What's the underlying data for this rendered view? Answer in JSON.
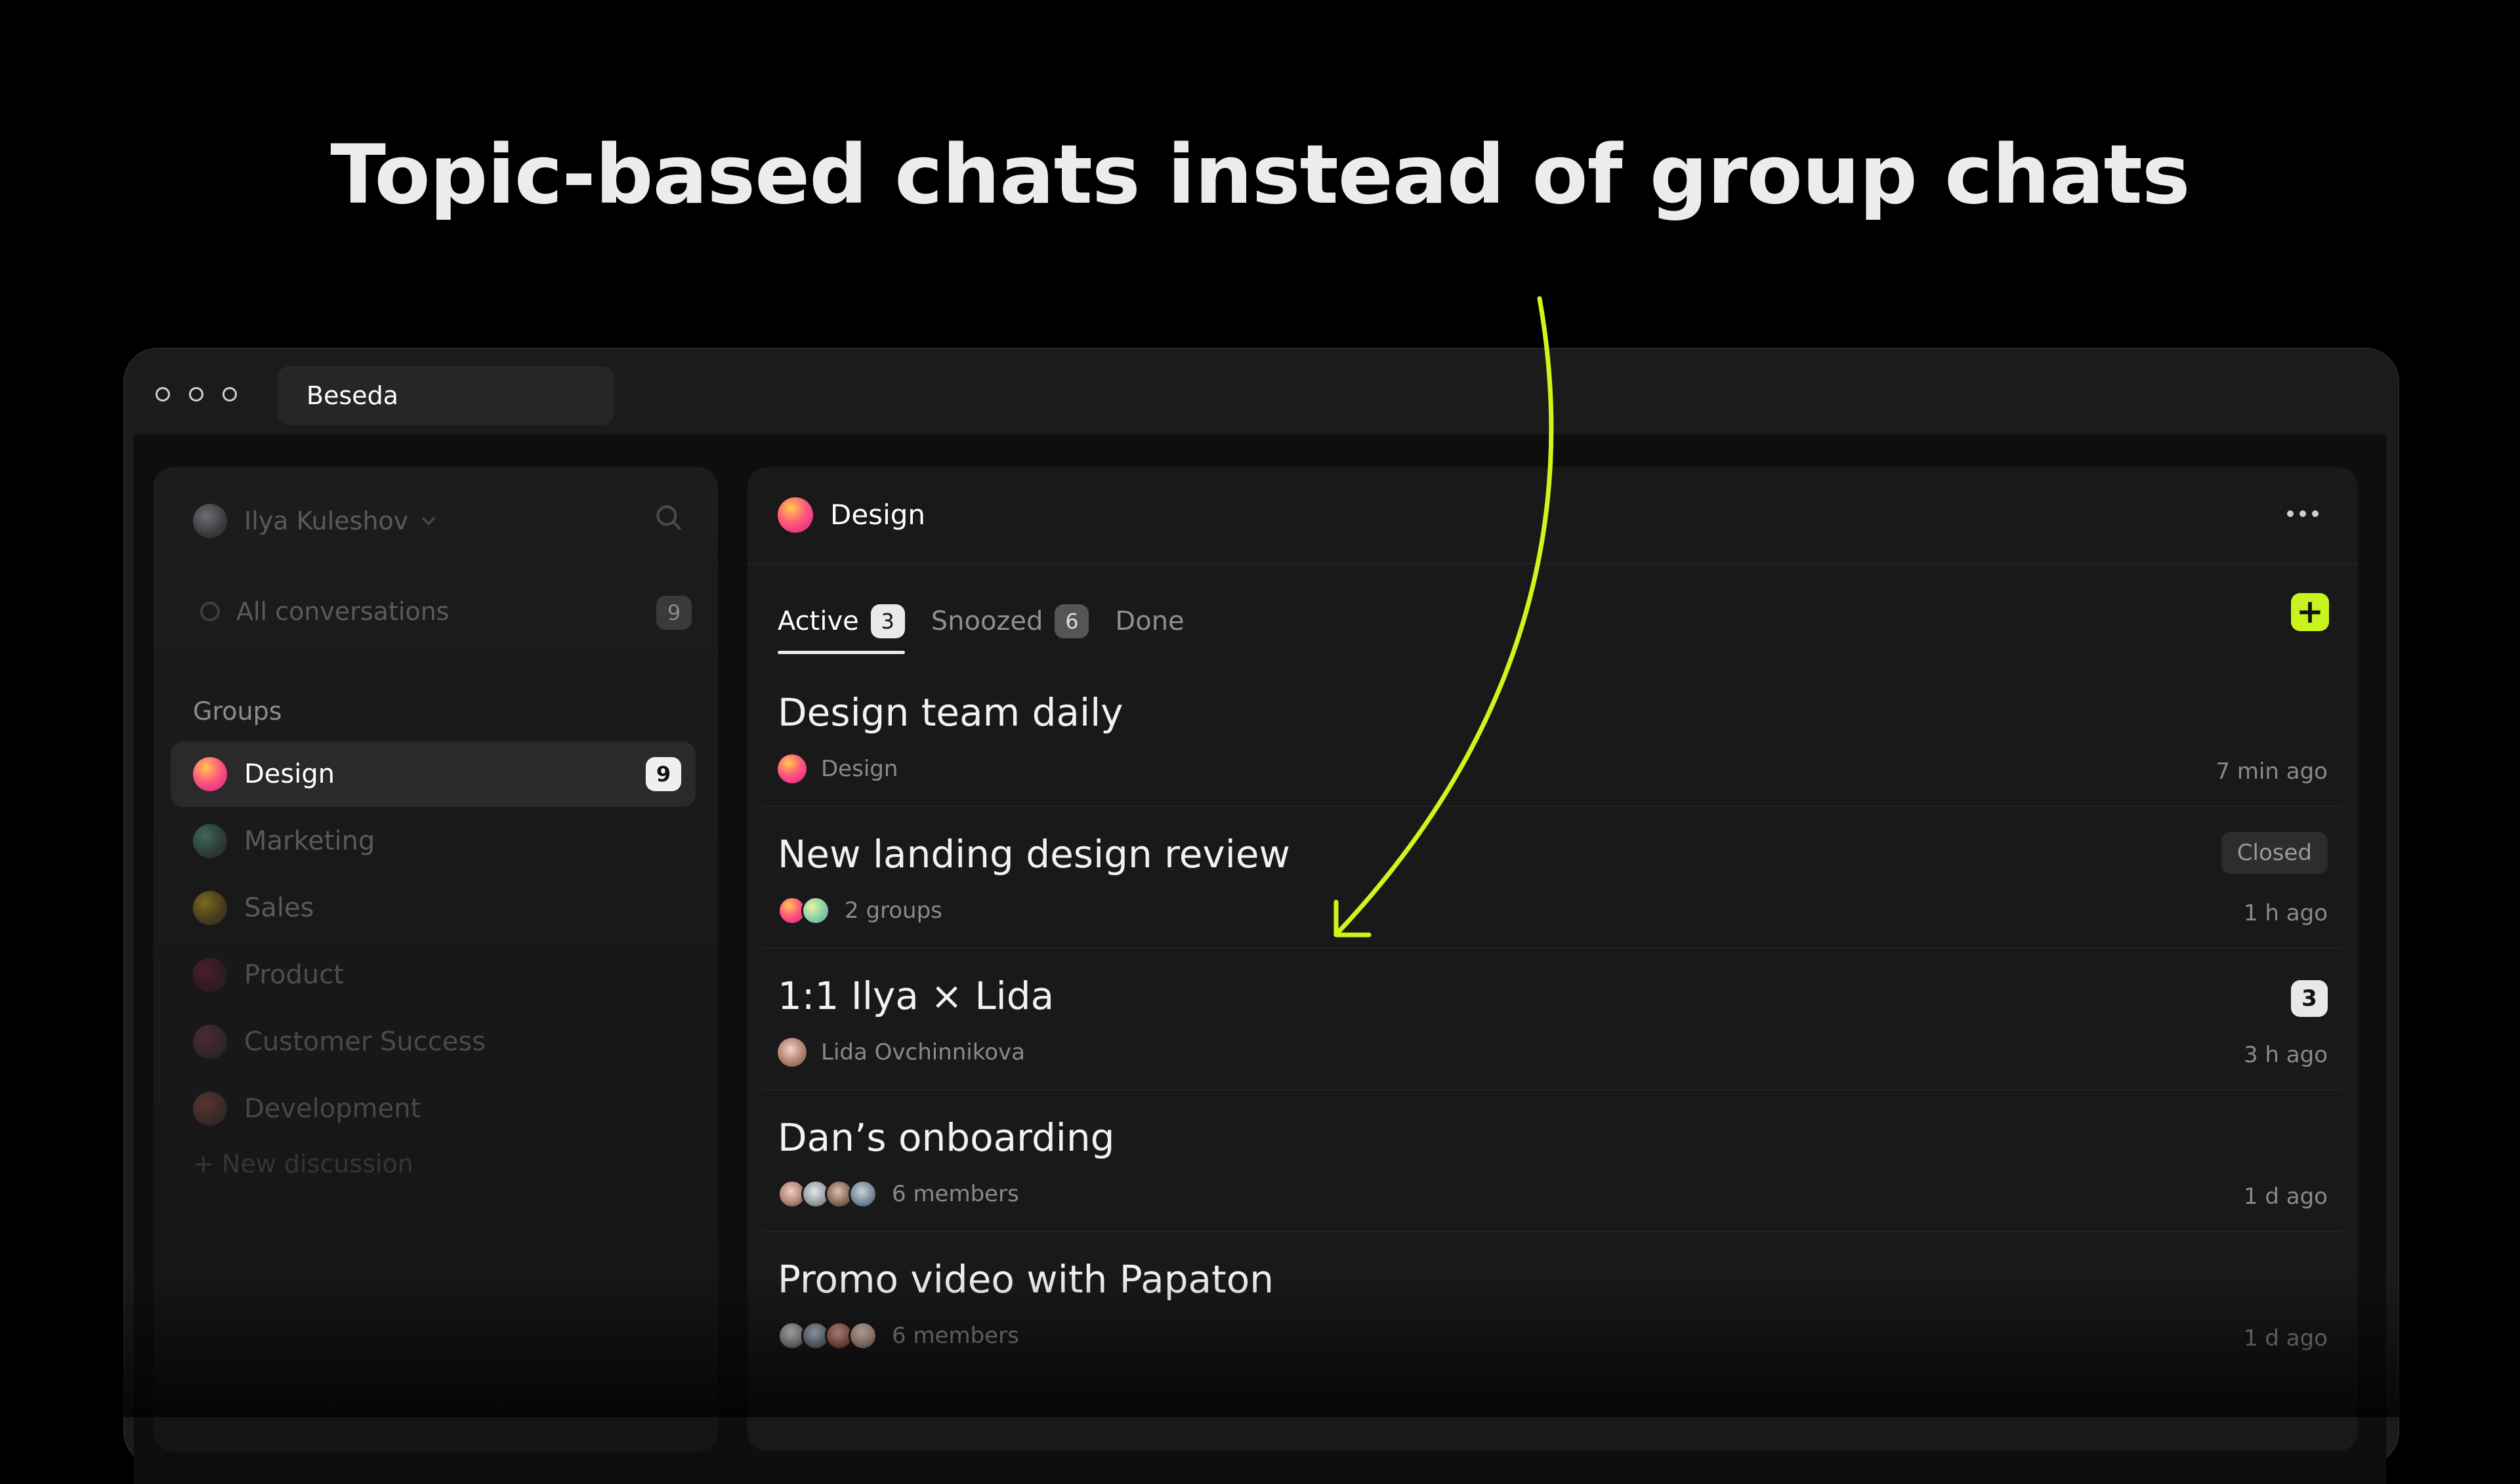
{
  "headline": "Topic-based chats instead of group chats",
  "window": {
    "title": "Beseda"
  },
  "colors": {
    "accent": "#c8f31e",
    "arrow": "#d6f21c"
  },
  "sidebar": {
    "user_name": "Ilya Kuleshov",
    "all_conversations": {
      "label": "All conversations",
      "count": "9"
    },
    "groups_label": "Groups",
    "groups": [
      {
        "label": "Design",
        "count": "9",
        "active": true
      },
      {
        "label": "Marketing"
      },
      {
        "label": "Sales"
      },
      {
        "label": "Product"
      },
      {
        "label": "Customer Success"
      },
      {
        "label": "Development"
      }
    ],
    "new_discussion": "+ New discussion"
  },
  "main": {
    "title": "Design",
    "tabs": [
      {
        "label": "Active",
        "count": "3"
      },
      {
        "label": "Snoozed",
        "count": "6"
      },
      {
        "label": "Done"
      }
    ],
    "add_label": "+",
    "chats": [
      {
        "title": "Design team daily",
        "sub": "Design",
        "time": "7 min ago"
      },
      {
        "title": "New landing design review",
        "sub": "2 groups",
        "time": "1 h ago",
        "status": "Closed"
      },
      {
        "title": "1:1 Ilya × Lida",
        "sub": "Lida Ovchinnikova",
        "time": "3 h ago",
        "unread": "3"
      },
      {
        "title": "Dan’s onboarding",
        "sub": "6 members",
        "time": "1 d ago"
      },
      {
        "title": "Promo video with Papaton",
        "sub": "6 members",
        "time": "1 d ago"
      }
    ]
  }
}
